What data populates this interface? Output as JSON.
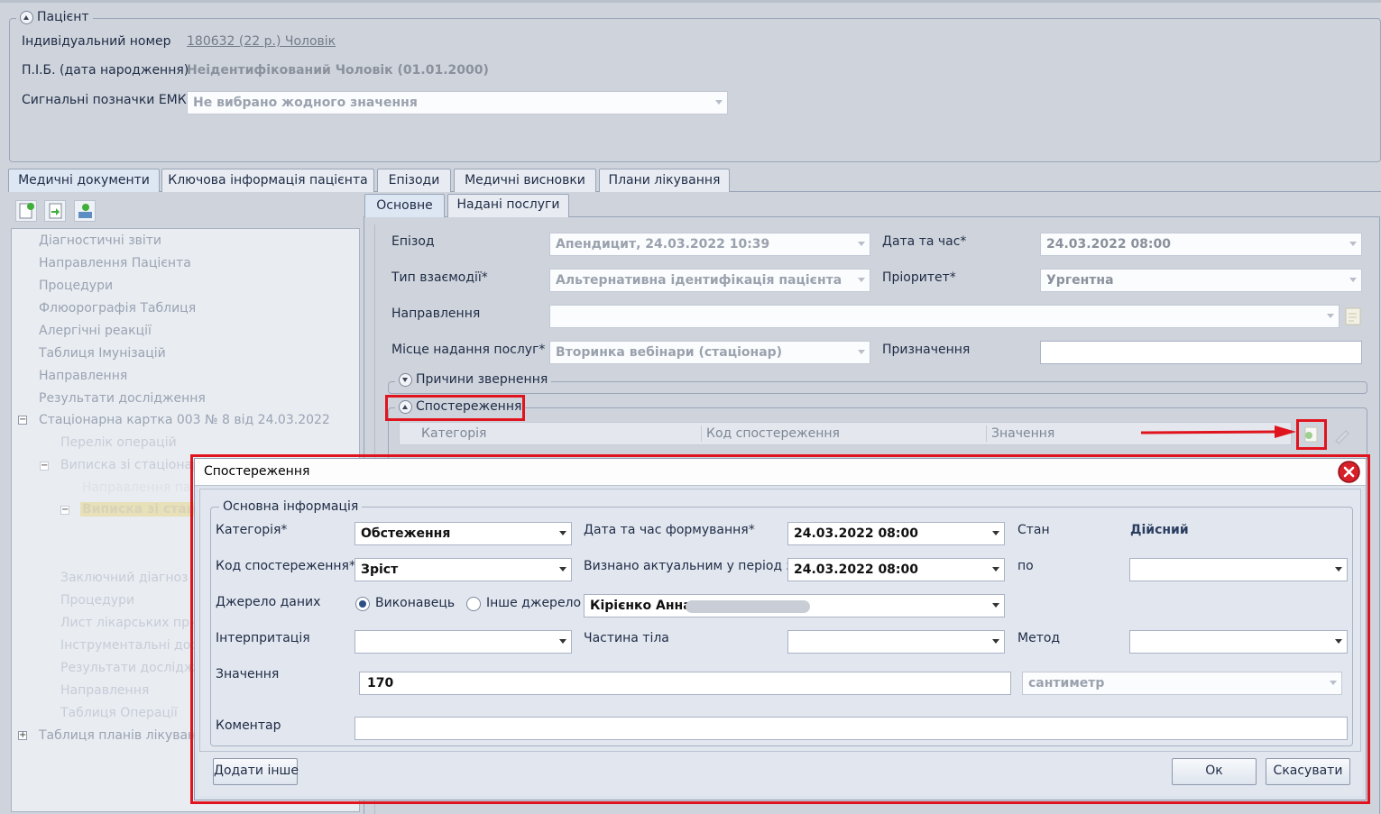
{
  "patient": {
    "section_title": "Пацієнт",
    "individual_number_label": "Індивідуальний номер",
    "individual_number_value": "180632 (22 р.) Чоловік",
    "name_label": "П.І.Б. (дата народження)",
    "name_value": "Неідентифікований Чоловік (01.01.2000)",
    "signal_label": "Сигнальні позначки ЕМК",
    "signal_value": "Не вибрано жодного значення"
  },
  "main_tabs": [
    "Медичні документи",
    "Ключова інформація пацієнта",
    "Епізоди",
    "Медичні висновки",
    "Плани лікування"
  ],
  "sub_tabs": [
    "Основне",
    "Надані послуги"
  ],
  "tree": {
    "items": [
      "Діагностичні звіти",
      "Направлення Пацієнта",
      "Процедури",
      "Флюорографія Таблиця",
      "Алергічні реакції",
      "Таблиця Імунізацій",
      "Направлення",
      "Результати дослідження"
    ],
    "card": "Стаціонарна картка 003 № 8 від 24.03.2022",
    "sub_items_a": [
      "Перелік операцій",
      "Виписка зі стаціонар"
    ],
    "sub_sub": "Направлення па",
    "sub_sub_b": "Виписка зі стаці",
    "sub_items_b": [
      "Заключний діагноз",
      "Процедури",
      "Лист лікарських приз",
      "Інструментальні досл",
      "Результати дослідже",
      "Направлення",
      "Таблиця Операції"
    ],
    "last": "Таблиця планів лікуванн"
  },
  "form": {
    "episode_label": "Епізод",
    "episode_value": "Апендицит, 24.03.2022 10:39",
    "datetime_label": "Дата та час*",
    "datetime_value": "24.03.2022 08:00",
    "interaction_label": "Тип взаємодії*",
    "interaction_value": "Альтернативна ідентифікація пацієнта",
    "priority_label": "Пріоритет*",
    "priority_value": "Ургентна",
    "referral_label": "Направлення",
    "place_label": "Місце надання послуг*",
    "place_value": "Вторинка вебінари (стаціонар)",
    "purpose_label": "Призначення",
    "reasons_title": "Причини звернення",
    "observations_title": "Спостереження",
    "grid_columns": [
      "Категорія",
      "Код спостереження",
      "Значення"
    ]
  },
  "dialog": {
    "title": "Спостереження",
    "group_title": "Основна інформація",
    "category_label": "Категорія*",
    "category_value": "Обстеження",
    "formed_label": "Дата та час формування*",
    "formed_value": "24.03.2022 08:00",
    "state_label": "Стан",
    "state_value": "Дійсний",
    "code_label": "Код спостереження*",
    "code_value": "Зріст",
    "actual_label": "Визнано актуальним у період з",
    "actual_value": "24.03.2022 08:00",
    "to_label": "по",
    "source_label": "Джерело даних",
    "source_option_1": "Виконавець",
    "source_option_2": "Інше джерело",
    "performer_value": "Кірієнко Анна",
    "interpretation_label": "Інтерпритація",
    "bodypart_label": "Частина тіла",
    "method_label": "Метод",
    "value_label": "Значення",
    "value_value": "170",
    "unit_value": "сантиметр",
    "comment_label": "Коментар",
    "add_other_label": "Додати інше",
    "ok_label": "Ок",
    "cancel_label": "Скасувати"
  },
  "colors": {
    "highlight": "#e0141e",
    "background": "#cfd4dc"
  }
}
